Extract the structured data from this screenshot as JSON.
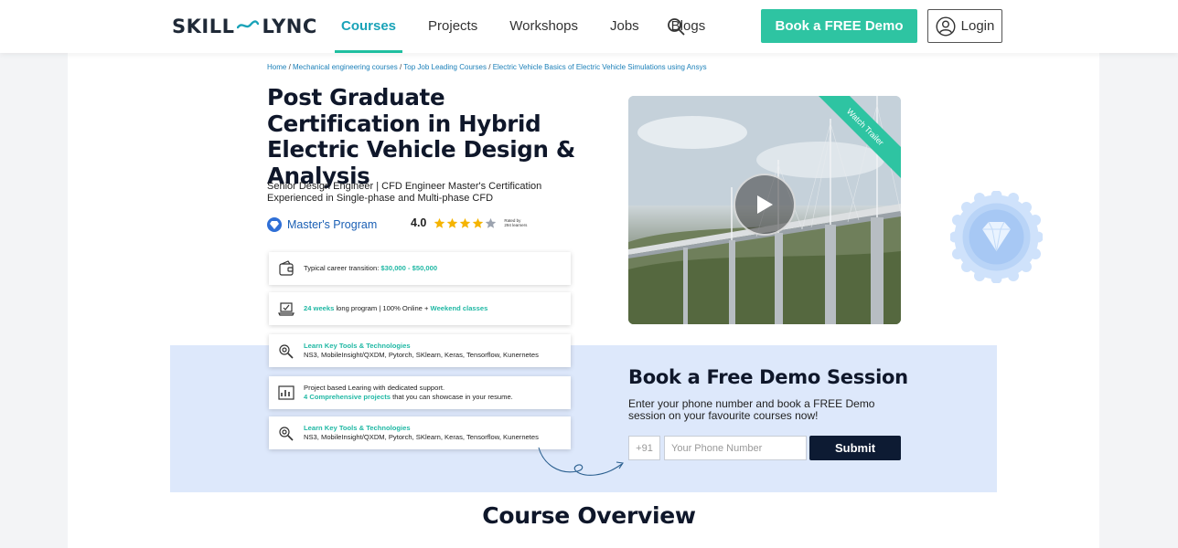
{
  "header": {
    "logo_left": "SKILL",
    "logo_right": "LYNC",
    "nav": [
      {
        "label": "Courses"
      },
      {
        "label": "Projects"
      },
      {
        "label": "Workshops"
      },
      {
        "label": "Jobs"
      },
      {
        "label": "Blogs"
      }
    ],
    "demo_button": "Book a FREE Demo",
    "login_button": "Login"
  },
  "breadcrumb": {
    "items": [
      "Home",
      "Mechanical engineering courses",
      "Top Job Leading Courses",
      "Electric Vehicle Basics of Electric Vehicle Simulations using Ansys"
    ],
    "separator": " / "
  },
  "course": {
    "title": "Post Graduate Certification in Hybrid Electric Vehicle Design & Analysis",
    "subtitle": "Senior Design Engineer | CFD Engineer Master's Certification Experienced in Single-phase and Multi-phase CFD",
    "program_label": "Master's Program",
    "rating": "4.0",
    "rated_by_line1": "Rated by",
    "rated_by_line2": "294 learners",
    "stars_filled": 4,
    "stars_total": 5
  },
  "cards": [
    {
      "pre": "Typical career transition: ",
      "hl": "$30,000 - $50,000",
      "post": ""
    },
    {
      "hl1": "24 weeks",
      "mid": " long program | 100% Online + ",
      "hl2": "Weekend classes"
    },
    {
      "heading": "Learn Key Tools & Technologies",
      "body": "NS3, MobileInsight/QXDM, Pytorch, SKlearn, Keras, Tensorflow, Kunernetes"
    },
    {
      "line1": "Project based Learing with dedicated support.",
      "hl": "4 Comprehensive projects",
      "post": " that you can showcase in your resume."
    },
    {
      "heading": "Learn Key Tools & Technologies",
      "body": "NS3, MobileInsight/QXDM, Pytorch, SKlearn, Keras, Tensorflow, Kunernetes"
    }
  ],
  "video": {
    "ribbon": "Watch Trailer"
  },
  "demo": {
    "title": "Book a Free Demo Session",
    "subtitle": "Enter your phone number and book a FREE Demo session on your favourite courses now!",
    "country_code": "+91",
    "phone_placeholder": "Your Phone Number",
    "submit": "Submit"
  },
  "overview_title": "Course Overview",
  "colors": {
    "accent": "#2ec4a2",
    "link": "#1a7fb8",
    "dark": "#0d1b33",
    "demo_bg": "#dde8fb"
  }
}
